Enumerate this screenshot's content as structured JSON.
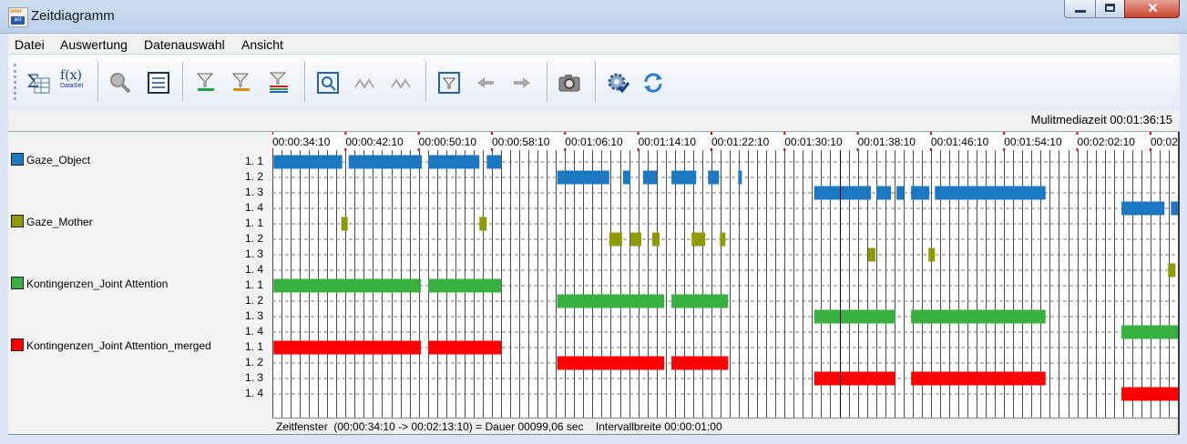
{
  "window": {
    "title": "Zeitdiagramm",
    "close_glyph": "✕"
  },
  "menu": [
    "Datei",
    "Auswertung",
    "Datenauswahl",
    "Ansicht"
  ],
  "toolbar_icons": [
    "sum-table-icon",
    "function-dataset-icon",
    "magnifier-disabled-icon",
    "list-view-icon",
    "filter-green-icon",
    "filter-orange-icon",
    "filter-multi-icon",
    "zoom-window-icon",
    "connect-disabled-icon",
    "connect2-disabled-icon",
    "filter-window-icon",
    "arrow-left-disabled-icon",
    "arrow-right-disabled-icon",
    "camera-icon",
    "settings-check-icon",
    "refresh-icon"
  ],
  "toolbar_labels": {
    "fx": "f(x)",
    "dataset": "DataSet"
  },
  "multimedia_time": "Mulitmediazeit 00:01:36:15",
  "status": "Zeitfenster  (00:00:34:10 -> 00:02:13:10) = Dauer 00099,06 sec    Intervallbreite 00:00:01:00",
  "colors": {
    "blue": "#1c78c0",
    "olive": "#8f9a06",
    "green": "#37b040",
    "red": "#ff0000",
    "marker": "#d40000"
  },
  "chart_data": {
    "type": "timeline",
    "x_range": [
      34.1667,
      133.1667
    ],
    "time_format": "HH:MM:SS:FF",
    "tick_labels": [
      "00:00:34:10",
      "00:00:42:10",
      "00:00:50:10",
      "00:00:58:10",
      "00:01:06:10",
      "00:01:14:10",
      "00:01:22:10",
      "00:01:30:10",
      "00:01:38:10",
      "00:01:46:10",
      "00:01:54:10",
      "00:02:02:10",
      "00:02"
    ],
    "tick_seconds": [
      34.1667,
      42.1667,
      50.1667,
      58.1667,
      66.1667,
      74.1667,
      82.1667,
      90.1667,
      98.1667,
      106.1667,
      114.1667,
      122.1667,
      130.1667
    ],
    "grid_interval": 1,
    "current_time": 96.25,
    "groups": [
      {
        "name": "Gaze_Object",
        "color": "#1c78c0",
        "rows": [
          {
            "label": "1. 1",
            "intervals": [
              [
                34.3,
                41.8
              ],
              [
                42.5,
                50.5
              ],
              [
                51.2,
                56.8
              ],
              [
                57.6,
                59.2
              ]
            ]
          },
          {
            "label": "1. 2",
            "intervals": [
              [
                65.3,
                71.0
              ],
              [
                72.5,
                73.3
              ],
              [
                74.7,
                76.2
              ],
              [
                77.8,
                80.5
              ],
              [
                81.8,
                83.0
              ],
              [
                85.1,
                85.5
              ]
            ]
          },
          {
            "label": "1. 3",
            "intervals": [
              [
                93.4,
                99.6
              ],
              [
                100.2,
                101.8
              ],
              [
                102.4,
                103.2
              ],
              [
                104.0,
                106.0
              ],
              [
                106.6,
                118.7
              ]
            ]
          },
          {
            "label": "1. 4",
            "intervals": [
              [
                127.0,
                131.7
              ],
              [
                132.4,
                133.2
              ]
            ]
          }
        ]
      },
      {
        "name": "Gaze_Mother",
        "color": "#8f9a06",
        "rows": [
          {
            "label": "1. 1",
            "intervals": [
              [
                41.7,
                42.4
              ],
              [
                56.8,
                57.6
              ]
            ]
          },
          {
            "label": "1. 2",
            "intervals": [
              [
                71.0,
                72.4
              ],
              [
                73.3,
                74.5
              ],
              [
                75.7,
                76.5
              ],
              [
                80.0,
                81.5
              ],
              [
                83.1,
                83.7
              ]
            ]
          },
          {
            "label": "1. 3",
            "intervals": [
              [
                99.3,
                100.1
              ],
              [
                105.9,
                106.6
              ]
            ]
          },
          {
            "label": "1. 4",
            "intervals": [
              [
                132.1,
                132.9
              ]
            ]
          }
        ]
      },
      {
        "name": "Kontingenzen_Joint Attention",
        "color": "#37b040",
        "rows": [
          {
            "label": "1. 1",
            "intervals": [
              [
                34.3,
                50.4
              ],
              [
                51.2,
                59.2
              ]
            ]
          },
          {
            "label": "1. 2",
            "intervals": [
              [
                65.3,
                77.0
              ],
              [
                77.8,
                84.0
              ]
            ]
          },
          {
            "label": "1. 3",
            "intervals": [
              [
                93.4,
                102.3
              ],
              [
                104.0,
                118.7
              ]
            ]
          },
          {
            "label": "1. 4",
            "intervals": [
              [
                127.0,
                133.2
              ]
            ]
          }
        ]
      },
      {
        "name": "Kontingenzen_Joint Attention_merged",
        "color": "#ff0000",
        "rows": [
          {
            "label": "1. 1",
            "intervals": [
              [
                34.3,
                50.4
              ],
              [
                51.2,
                59.2
              ]
            ]
          },
          {
            "label": "1. 2",
            "intervals": [
              [
                65.3,
                77.0
              ],
              [
                77.8,
                84.0
              ]
            ]
          },
          {
            "label": "1. 3",
            "intervals": [
              [
                93.4,
                102.3
              ],
              [
                104.0,
                118.7
              ]
            ]
          },
          {
            "label": "1. 4",
            "intervals": [
              [
                127.0,
                133.2
              ]
            ]
          }
        ]
      }
    ]
  }
}
